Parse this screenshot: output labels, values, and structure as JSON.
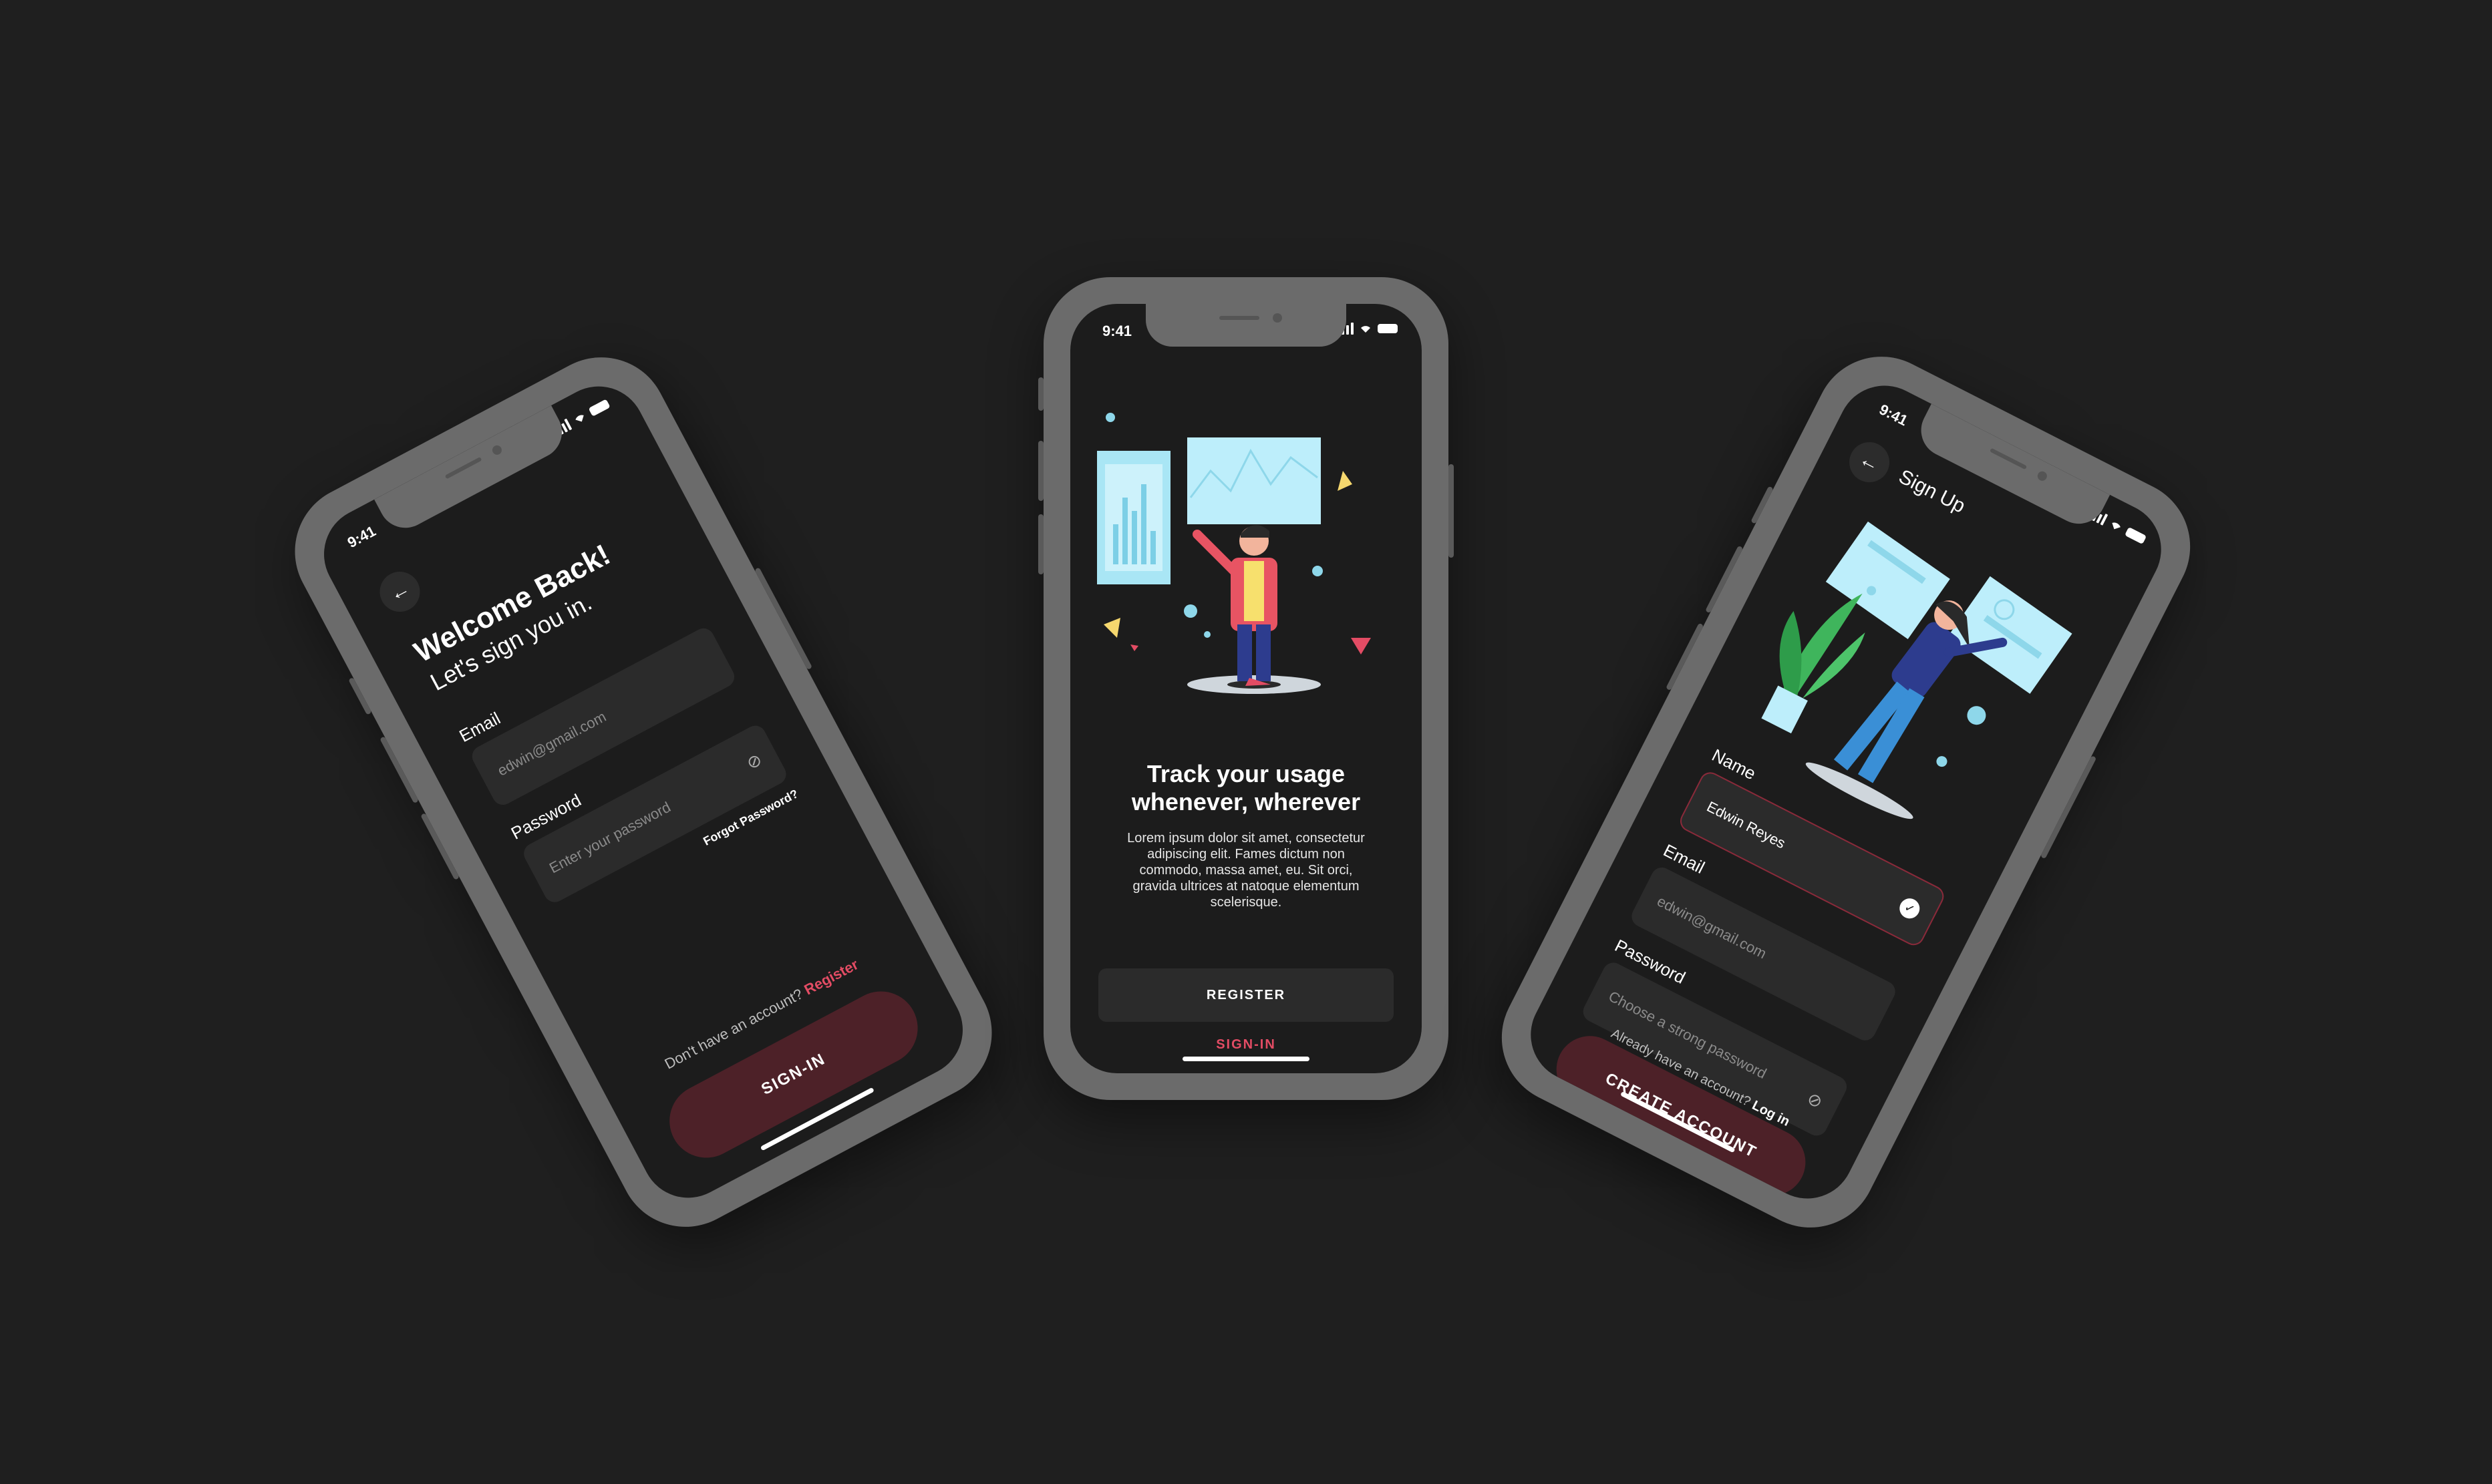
{
  "status": {
    "time": "9:41"
  },
  "signin": {
    "title": "Welcome Back!",
    "subtitle": "Let's sign you in.",
    "email_label": "Email",
    "email_placeholder": "edwin@gmail.com",
    "password_label": "Password",
    "password_placeholder": "Enter your password",
    "forgot": "Forgot Password?",
    "no_account": "Don't have an account?",
    "register_link": "Register",
    "cta": "SIGN-IN"
  },
  "onboarding": {
    "title": "Track your usage whenever, wherever",
    "body": "Lorem ipsum dolor sit amet, consectetur adipiscing elit. Fames dictum non commodo, massa amet, eu. Sit orci, gravida ultrices at natoque elementum scelerisque.",
    "register_button": "REGISTER",
    "signin_link": "SIGN-IN"
  },
  "signup": {
    "title": "Sign Up",
    "name_label": "Name",
    "name_value": "Edwin Reyes",
    "email_label": "Email",
    "email_placeholder": "edwin@gmail.com",
    "password_label": "Password",
    "password_placeholder": "Choose a strong password",
    "cta": "CREATE ACCOUNT",
    "have_account": "Already have an account?",
    "login_link": "Log in"
  },
  "colors": {
    "background": "#1f1f1f",
    "phone_frame": "#6b6b6b",
    "screen": "#1c1c1c",
    "field": "#2b2b2b",
    "accent": "#e34c64",
    "cta_dark_red": "#4d2128"
  },
  "icons": [
    "back-arrow-icon",
    "eye-off-icon",
    "check-icon",
    "signal-icon",
    "wifi-icon",
    "battery-icon"
  ]
}
